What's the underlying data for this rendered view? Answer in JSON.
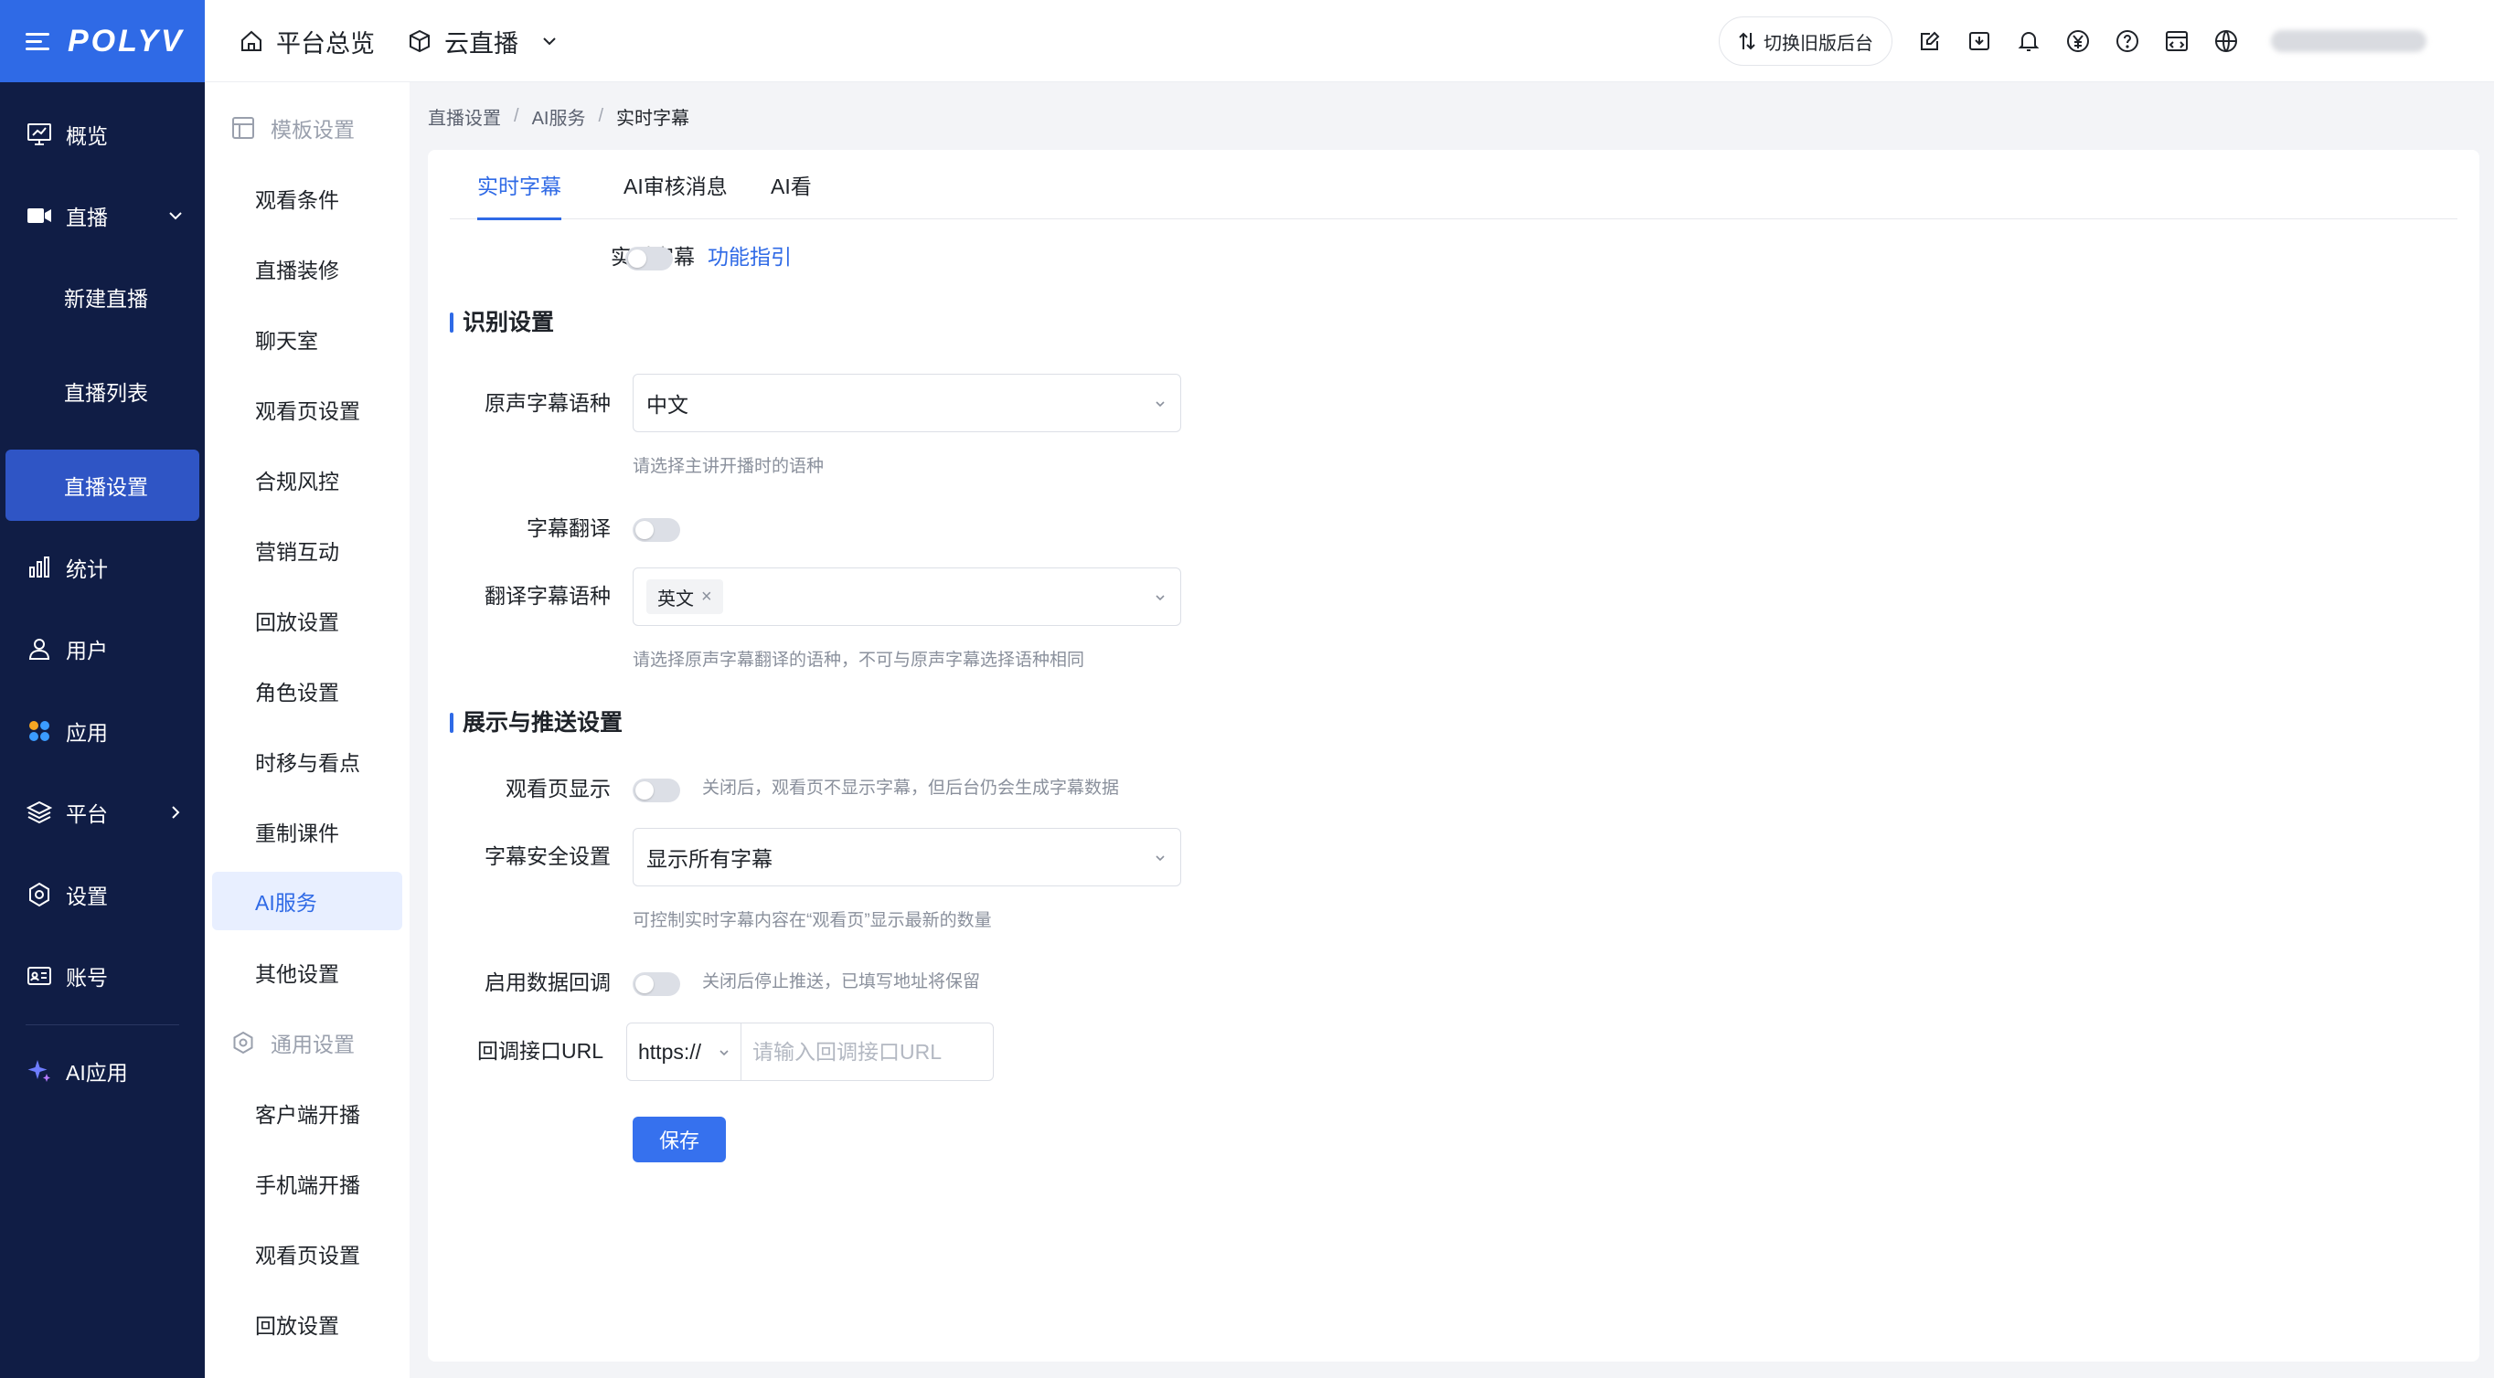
{
  "brand": {
    "logo": "POLYV"
  },
  "nav": {
    "items": [
      {
        "label": "概览",
        "icon": "monitor-chart-icon"
      },
      {
        "label": "直播",
        "icon": "video-camera-icon"
      },
      {
        "label": "统计",
        "icon": "bar-chart-icon"
      },
      {
        "label": "用户",
        "icon": "user-icon"
      },
      {
        "label": "应用",
        "icon": "apps-icon"
      },
      {
        "label": "平台",
        "icon": "layers-icon"
      },
      {
        "label": "设置",
        "icon": "gear-icon"
      },
      {
        "label": "账号",
        "icon": "id-card-icon"
      },
      {
        "label": "AI应用",
        "icon": "sparkle-icon"
      }
    ],
    "live_sub": [
      "新建直播",
      "直播列表",
      "直播设置"
    ]
  },
  "submenu": {
    "group1": "模板设置",
    "group1_items": [
      "观看条件",
      "直播装修",
      "聊天室",
      "观看页设置",
      "合规风控",
      "营销互动",
      "回放设置",
      "角色设置",
      "时移与看点",
      "重制课件",
      "AI服务",
      "其他设置"
    ],
    "group2": "通用设置",
    "group2_items": [
      "客户端开播",
      "手机端开播",
      "观看页设置",
      "回放设置"
    ]
  },
  "topbar": {
    "crumb1": "平台总览",
    "crumb2": "云直播",
    "switch_old": "切换旧版后台"
  },
  "breadcrumb": [
    "直播设置",
    "AI服务",
    "实时字幕"
  ],
  "tabs": [
    "实时字幕",
    "AI审核消息",
    "AI看"
  ],
  "form": {
    "realtime_label": "实时字幕",
    "guide_link": "功能指引",
    "section1": "识别设置",
    "src_lang_label": "原声字幕语种",
    "src_lang_value": "中文",
    "src_lang_hint": "请选择主讲开播时的语种",
    "translate_label": "字幕翻译",
    "trans_lang_label": "翻译字幕语种",
    "trans_lang_tag": "英文",
    "trans_lang_hint": "请选择原声字幕翻译的语种，不可与原声字幕选择语种相同",
    "section2": "展示与推送设置",
    "watch_show_label": "观看页显示",
    "watch_show_hint": "关闭后，观看页不显示字幕，但后台仍会生成字幕数据",
    "safety_label": "字幕安全设置",
    "safety_value": "显示所有字幕",
    "safety_hint": "可控制实时字幕内容在“观看页”显示最新的数量",
    "callback_label": "启用数据回调",
    "callback_hint": "关闭后停止推送，已填写地址将保留",
    "url_label": "回调接口URL",
    "url_protocol": "https://",
    "url_placeholder": "请输入回调接口URL",
    "save": "保存"
  }
}
